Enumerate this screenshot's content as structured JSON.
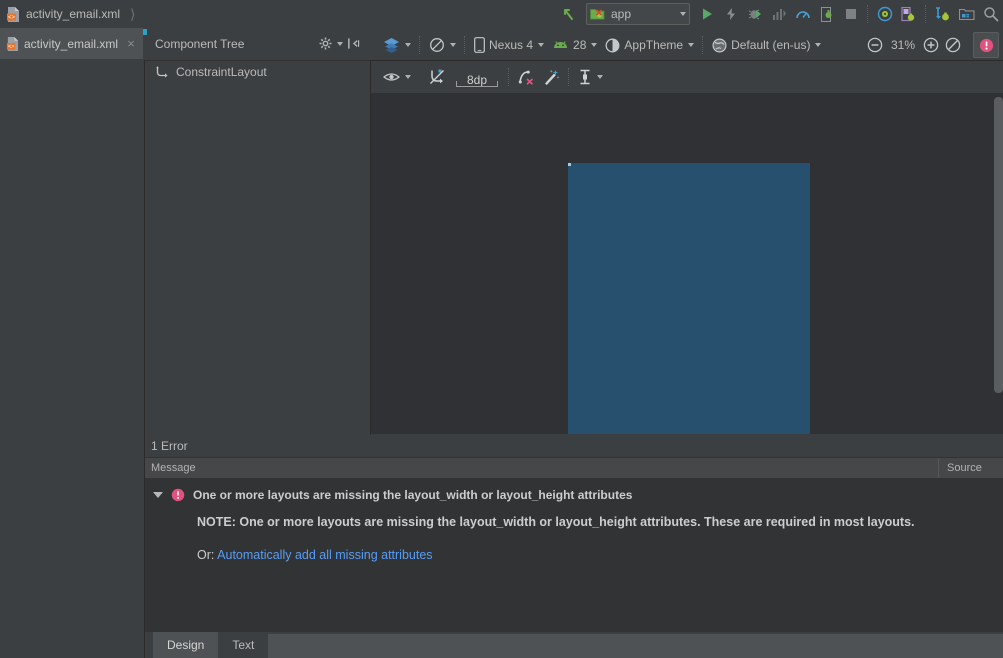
{
  "window": {
    "breadcrumb": {
      "file": "activity_email.xml"
    }
  },
  "toolbar_top": {
    "run_config": {
      "label": "app",
      "icon": "android-module-icon"
    },
    "buttons": [
      {
        "name": "back-arrow-icon",
        "label": ""
      },
      {
        "name": "run-icon",
        "label": ""
      },
      {
        "name": "apply-changes-icon",
        "label": ""
      },
      {
        "name": "debug-icon",
        "label": ""
      },
      {
        "name": "run-with-coverage-icon",
        "label": ""
      },
      {
        "name": "profiler-icon",
        "label": ""
      },
      {
        "name": "stop-icon",
        "label": ""
      },
      {
        "name": "avd-manager-icon",
        "label": ""
      },
      {
        "name": "sdk-manager-icon",
        "label": ""
      },
      {
        "name": "layout-inspector-icon",
        "label": ""
      },
      {
        "name": "project-structure-icon",
        "label": ""
      },
      {
        "name": "search-everywhere-icon",
        "label": ""
      }
    ]
  },
  "editor_tab": {
    "title": "activity_email.xml",
    "close_label": "×"
  },
  "component_tree": {
    "title": "Component Tree",
    "gear_icon": "gear-icon",
    "collapse_icon": "collapse-all-icon",
    "items": [
      {
        "label": "ConstraintLayout",
        "icon": "constraint-layout-icon"
      }
    ]
  },
  "design_toolbar": {
    "row1": [
      {
        "name": "design-mode-select",
        "label": "",
        "icon": "layers-icon",
        "has_caret": true
      },
      {
        "name": "orientation-select",
        "label": "",
        "icon": "rotate-icon",
        "has_caret": true
      },
      {
        "name": "device-select",
        "label": "Nexus 4",
        "icon": "phone-icon",
        "has_caret": true
      },
      {
        "name": "api-level-select",
        "label": "28",
        "icon": "android-head-icon",
        "has_caret": true
      },
      {
        "name": "theme-select",
        "label": "AppTheme",
        "icon": "theme-contrast-icon",
        "has_caret": true
      },
      {
        "name": "locale-select",
        "label": "Default (en-us)",
        "icon": "globe-icon",
        "has_caret": true
      }
    ],
    "zoom": {
      "out_label": "zoom-out-icon",
      "percent": "31%",
      "in_label": "zoom-in-icon",
      "fit_label": "zoom-fit-icon",
      "error_badge": "error-badge-icon"
    },
    "row2": [
      {
        "name": "view-options-button",
        "icon": "eye-icon",
        "has_caret": true
      },
      {
        "name": "toggle-autoconnect-button",
        "icon": "autoconnect-off-icon",
        "has_caret": false
      },
      {
        "name": "default-margin-stepper",
        "label": "8dp",
        "icon": "margin-icon",
        "has_caret": false
      },
      {
        "name": "clear-constraints-button",
        "icon": "clear-constraints-icon",
        "has_caret": false
      },
      {
        "name": "infer-constraints-button",
        "icon": "magic-wand-icon",
        "has_caret": false
      },
      {
        "name": "align-guidelines-button",
        "icon": "guideline-icon",
        "has_caret": true
      }
    ]
  },
  "canvas": {
    "device_preview": {
      "fill_color": "#27506f",
      "background": "#2f3134"
    }
  },
  "messages_panel": {
    "error_count": "1 Error",
    "columns": {
      "message": "Message",
      "source": "Source"
    },
    "rows": [
      {
        "icon": "error-icon",
        "expander": "expanded-triangle-icon",
        "title": "One or more layouts are missing the layout_width or layout_height attributes",
        "note": "NOTE: One or more layouts are missing the layout_width or layout_height attributes. These are required in most layouts.",
        "or_prefix": "Or:",
        "link": "Automatically add all missing attributes"
      }
    ]
  },
  "bottom_tabs": [
    {
      "label": "Design",
      "active": true
    },
    {
      "label": "Text",
      "active": false
    }
  ],
  "colors": {
    "accent_cyan": "#2aa3c4",
    "error_red": "#e2527f",
    "link_blue": "#589df6",
    "device_blue": "#27506f",
    "panel_bg": "#3c3f41",
    "canvas_bg": "#2f3134"
  }
}
